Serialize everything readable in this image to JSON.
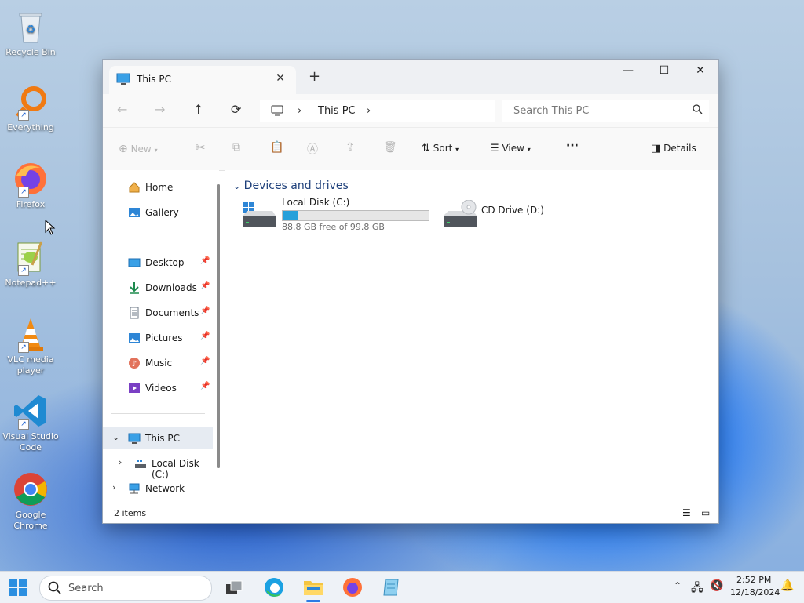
{
  "desktop": {
    "icons": [
      {
        "label": "Recycle Bin"
      },
      {
        "label": "Everything"
      },
      {
        "label": "Firefox"
      },
      {
        "label": "Notepad++"
      },
      {
        "label": "VLC media player"
      },
      {
        "label": "Visual Studio Code"
      },
      {
        "label": "Google Chrome"
      }
    ]
  },
  "window": {
    "tab_title": "This PC",
    "tab_close": "✕",
    "new_tab": "+",
    "controls": {
      "minimize": "—",
      "maximize": "☐",
      "close": "✕"
    },
    "nav": {
      "back": "←",
      "forward": "→",
      "up": "↑",
      "refresh": "⟳"
    },
    "address": {
      "separator": "›",
      "location": "This PC"
    },
    "search": {
      "placeholder": "Search This PC"
    },
    "toolbar": {
      "new_label": "New",
      "sort_label": "Sort",
      "view_label": "View",
      "more_label": "···",
      "details_label": "Details"
    },
    "sidebar": {
      "home": "Home",
      "gallery": "Gallery",
      "quick": [
        {
          "label": "Desktop"
        },
        {
          "label": "Downloads"
        },
        {
          "label": "Documents"
        },
        {
          "label": "Pictures"
        },
        {
          "label": "Music"
        },
        {
          "label": "Videos"
        }
      ],
      "this_pc": "This PC",
      "local_disk": "Local Disk (C:)",
      "network": "Network"
    },
    "content": {
      "group_header": "Devices and drives",
      "drives": [
        {
          "name": "Local Disk (C:)",
          "free_text": "88.8 GB free of 99.8 GB",
          "used_fraction": 0.11
        },
        {
          "name": "CD Drive (D:)"
        }
      ]
    },
    "status": {
      "items_count": "2 items"
    }
  },
  "taskbar": {
    "search_placeholder": "Search",
    "time": "2:52 PM",
    "date": "12/18/2024"
  },
  "colors": {
    "accent": "#26a0da",
    "selection": "#e6ebf2",
    "folder_yellow": "#f4c542"
  }
}
